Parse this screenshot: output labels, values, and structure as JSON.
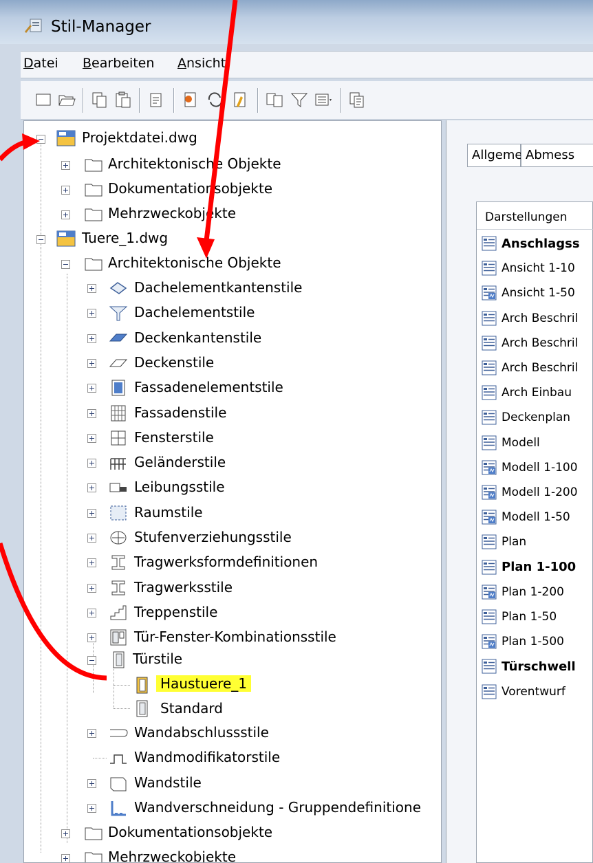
{
  "window": {
    "title": "Stil-Manager"
  },
  "menu": [
    "Datei",
    "Bearbeiten",
    "Ansicht"
  ],
  "toolbar": {
    "icons": [
      "new-icon",
      "open-icon",
      "copy-icon",
      "paste-icon",
      "purge-icon",
      "edit-style-icon",
      "sync-icon",
      "cleanup-icon",
      "filter-icon",
      "toggle-view-icon",
      "view-dropdown-icon",
      "inspect-icon"
    ]
  },
  "tree": {
    "root1": {
      "label": "Projektdatei.dwg",
      "children": [
        "Architektonische Objekte",
        "Dokumentationsobjekte",
        "Mehrzweckobjekte"
      ]
    },
    "root2": {
      "label": "Tuere_1.dwg",
      "arch": {
        "label": "Architektonische Objekte",
        "children": [
          "Dachelementkantenstile",
          "Dachelementstile",
          "Deckenkantenstile",
          "Deckenstile",
          "Fassadenelementstile",
          "Fassadenstile",
          "Fensterstile",
          "Geländerstile",
          "Leibungsstile",
          "Raumstile",
          "Stufenverziehungsstile",
          "Tragwerksformdefinitionen",
          "Tragwerksstile",
          "Treppenstile",
          "Tür-Fenster-Kombinationsstile"
        ]
      },
      "door": {
        "label": "Türstile",
        "children": [
          "Haustuere_1",
          "Standard"
        ]
      },
      "after": [
        "Wandabschlussstile",
        "Wandmodifikatorstile",
        "Wandstile",
        "Wandverschneidung - Gruppendefinitione"
      ],
      "tail": [
        "Dokumentationsobjekte",
        "Mehrzweckobjekte"
      ]
    }
  },
  "right": {
    "tabs": [
      "Allgemein",
      "Abmess"
    ],
    "list_header": "Darstellungen",
    "items": [
      {
        "label": "Anschlagss",
        "bold": true,
        "icon": "rep-icon"
      },
      {
        "label": "Ansicht 1-10",
        "bold": false,
        "icon": "rep-icon"
      },
      {
        "label": "Ansicht 1-50",
        "bold": false,
        "icon": "rep-scale-icon"
      },
      {
        "label": "Arch Beschril",
        "bold": false,
        "icon": "rep-icon"
      },
      {
        "label": "Arch Beschril",
        "bold": false,
        "icon": "rep-icon"
      },
      {
        "label": "Arch Beschril",
        "bold": false,
        "icon": "rep-icon"
      },
      {
        "label": "Arch Einbau",
        "bold": false,
        "icon": "rep-icon"
      },
      {
        "label": "Deckenplan",
        "bold": false,
        "icon": "rep-icon"
      },
      {
        "label": "Modell",
        "bold": false,
        "icon": "rep-icon"
      },
      {
        "label": "Modell 1-100",
        "bold": false,
        "icon": "rep-scale-icon"
      },
      {
        "label": "Modell 1-200",
        "bold": false,
        "icon": "rep-scale-icon"
      },
      {
        "label": "Modell 1-50",
        "bold": false,
        "icon": "rep-scale-icon"
      },
      {
        "label": "Plan",
        "bold": false,
        "icon": "rep-icon"
      },
      {
        "label": "Plan 1-100",
        "bold": true,
        "icon": "rep-icon"
      },
      {
        "label": "Plan 1-200",
        "bold": false,
        "icon": "rep-scale-icon"
      },
      {
        "label": "Plan 1-50",
        "bold": false,
        "icon": "rep-icon"
      },
      {
        "label": "Plan 1-500",
        "bold": false,
        "icon": "rep-scale-icon"
      },
      {
        "label": "Türschwell",
        "bold": true,
        "icon": "rep-icon"
      },
      {
        "label": "Vorentwurf",
        "bold": false,
        "icon": "rep-icon"
      }
    ]
  },
  "colors": {
    "highlight": "#ffff33",
    "annotation_arrow": "#ff0000"
  }
}
